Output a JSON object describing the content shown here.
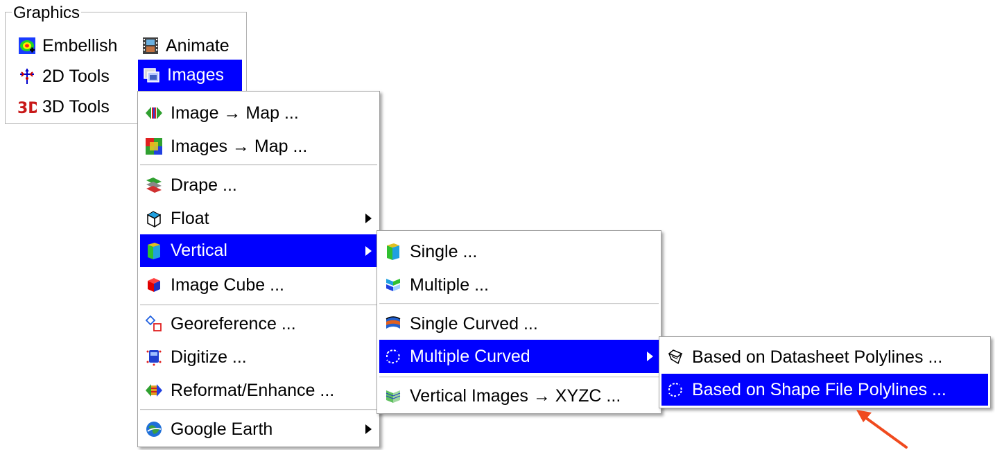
{
  "graphics_group": {
    "title": "Graphics",
    "buttons": {
      "embellish": "Embellish",
      "animate": "Animate",
      "tools2d": "2D Tools",
      "images": "Images",
      "tools3d": "3D Tools"
    }
  },
  "images_menu": {
    "items": {
      "image_to_map": "Image → Map ...",
      "images_to_map": "Images → Map ...",
      "drape": "Drape ...",
      "float": "Float",
      "vertical": "Vertical",
      "image_cube": "Image Cube ...",
      "georeference": "Georeference ...",
      "digitize": "Digitize ...",
      "reformat": "Reformat/Enhance ...",
      "google_earth": "Google Earth"
    }
  },
  "vertical_menu": {
    "items": {
      "single": "Single ...",
      "multiple": "Multiple ...",
      "single_curved": "Single Curved ...",
      "multiple_curved": "Multiple Curved",
      "vertical_images_xyzc": "Vertical Images → XYZC ..."
    }
  },
  "multiple_curved_menu": {
    "items": {
      "datasheet_polylines": "Based on Datasheet Polylines ...",
      "shape_file_polylines": "Based on Shape File Polylines ..."
    }
  },
  "colors": {
    "selection": "#0000ff",
    "callout_arrow": "#f04a1e"
  }
}
